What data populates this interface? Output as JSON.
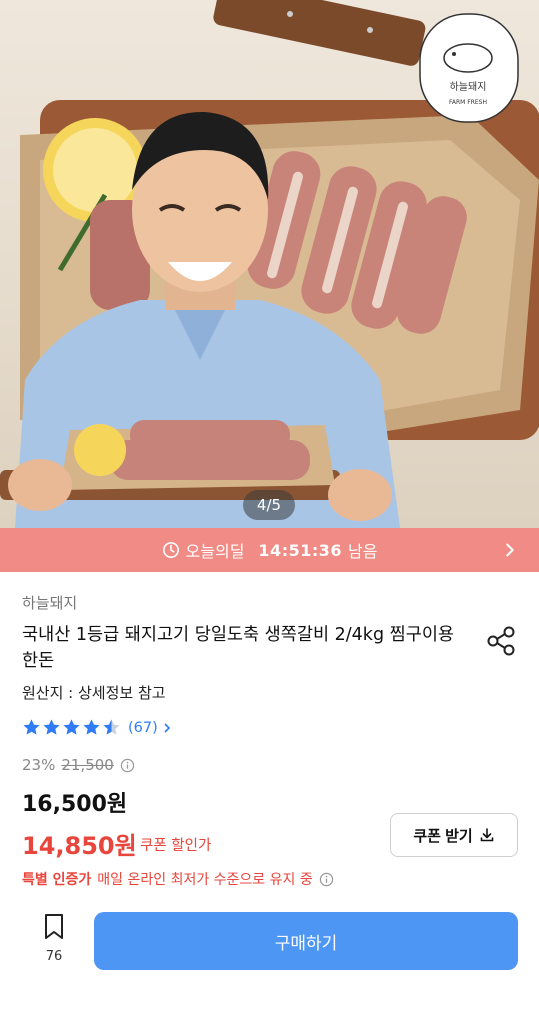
{
  "hero": {
    "image_counter": "4/5",
    "logo_text": "하늘돼지",
    "logo_subtext": "FARM FRESH"
  },
  "deal_bar": {
    "label": "오늘의딜",
    "timer": "14:51:36",
    "suffix": "남음",
    "color": "#f08b85"
  },
  "product": {
    "brand": "하늘돼지",
    "title": "국내산 1등급 돼지고기 당일도축 생쪽갈비 2/4kg 찜구이용 한돈",
    "origin": "원산지 : 상세정보 참고",
    "rating": 4.5,
    "review_count": "(67)",
    "discount_rate": "23%",
    "original_price": "21,500",
    "sale_price": "16,500원",
    "coupon_price": "14,850원",
    "coupon_label": "쿠폰 할인가",
    "coupon_button": "쿠폰 받기",
    "notice_highlight": "특별 인증가",
    "notice_text": "매일 온라인 최저가 수준으로 유지 중"
  },
  "bottom_bar": {
    "wishlist_count": "76",
    "buy_button": "구매하기"
  },
  "colors": {
    "accent_blue": "#4d96f3",
    "sale_red": "#e8453c",
    "star_blue": "#2f7cf6"
  },
  "icons": [
    "clock-icon",
    "chevron-right-icon",
    "share-icon",
    "star-icon",
    "info-icon",
    "download-icon",
    "bookmark-icon"
  ]
}
